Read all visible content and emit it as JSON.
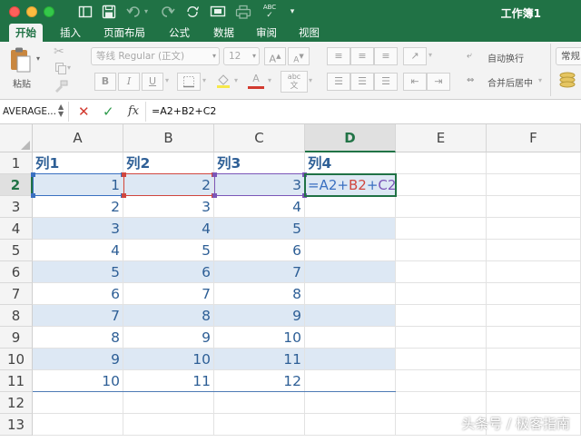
{
  "app": {
    "workbook_title": "工作簿1"
  },
  "ribbon_tabs": [
    "开始",
    "插入",
    "页面布局",
    "公式",
    "数据",
    "审阅",
    "视图"
  ],
  "ribbon": {
    "paste_label": "粘贴",
    "font_name": "等线 Regular (正文)",
    "font_size": "12",
    "font_grow": "A",
    "font_shrink": "A",
    "bold": "B",
    "italic": "I",
    "underline": "U",
    "font_color_glyph": "A",
    "abc_glyph": "abc",
    "wrap_text": "自动换行",
    "merge_center": "合并后居中",
    "number_format": "常规"
  },
  "formula_bar": {
    "name_box": "AVERAGE...",
    "fx_label": "fx",
    "formula": "=A2+B2+C2"
  },
  "sheet": {
    "columns": [
      "A",
      "B",
      "C",
      "D",
      "E",
      "F"
    ],
    "rows": [
      "1",
      "2",
      "3",
      "4",
      "5",
      "6",
      "7",
      "8",
      "9",
      "10",
      "11",
      "12",
      "13"
    ],
    "headers": [
      "列1",
      "列2",
      "列3",
      "列4"
    ],
    "data": [
      [
        "1",
        "2",
        "3"
      ],
      [
        "2",
        "3",
        "4"
      ],
      [
        "3",
        "4",
        "5"
      ],
      [
        "4",
        "5",
        "6"
      ],
      [
        "5",
        "6",
        "7"
      ],
      [
        "6",
        "7",
        "8"
      ],
      [
        "7",
        "8",
        "9"
      ],
      [
        "8",
        "9",
        "10"
      ],
      [
        "9",
        "10",
        "11"
      ],
      [
        "10",
        "11",
        "12"
      ]
    ],
    "editing_cell": "D2",
    "editing_formula_parts": {
      "eq": "=",
      "a2": "A2",
      "plus1": "+",
      "b2": "B2",
      "plus2": "+",
      "c2": "C2"
    },
    "selected_column": "D",
    "selected_row": "2"
  },
  "watermark": "头条号 / 极客指南",
  "colors": {
    "excel_green": "#207245",
    "band_blue": "#dde8f4",
    "cell_text_blue": "#2e5f96",
    "ref_a2": "#3a70c1",
    "ref_b2": "#d0463f",
    "ref_c2": "#7b56b8"
  }
}
